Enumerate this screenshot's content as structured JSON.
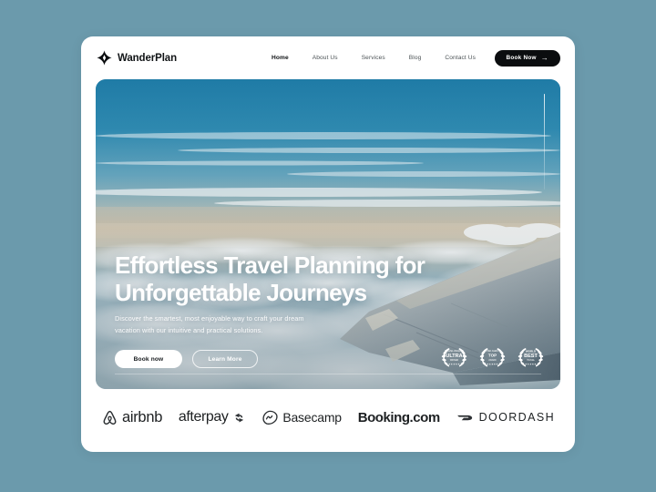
{
  "theme": {
    "page_background": "#6b9aac",
    "card_background": "#ffffff",
    "accent_dark": "#0b0d0f",
    "text_primary": "#111416",
    "text_muted": "#4c5356",
    "hero_sky_top": "#2a7fa8",
    "hero_haze": "#cfc3ad",
    "hero_cloud": "#e3eef3"
  },
  "navbar": {
    "logo_icon": "compass-star-icon",
    "brand": "WanderPlan",
    "links": [
      {
        "label": "Home",
        "active": true
      },
      {
        "label": "About Us",
        "active": false
      },
      {
        "label": "Services",
        "active": false
      },
      {
        "label": "Blog",
        "active": false
      },
      {
        "label": "Contact Us",
        "active": false
      }
    ],
    "cta": {
      "label": "Book Now",
      "icon": "arrow-right-icon",
      "arrow": "→"
    }
  },
  "hero": {
    "image_alt": "airplane-wing-above-clouds",
    "title_line1": "Effortless Travel Planning for",
    "title_line2": "Unforgettable Journeys",
    "subtitle_line1": "Discover the smartest, most enjoyable way to craft your dream",
    "subtitle_line2": "vacation with our intuitive and practical solutions.",
    "primary_cta": "Book now",
    "secondary_cta": "Learn More",
    "scroll_indicator": "vertical-scroll-line",
    "awards": [
      {
        "icon": "laurel-wreath-badge-icon",
        "title": "ULTRA",
        "sub1": "TRAVEL AWARDS",
        "sub2": "WINNER",
        "stars": "★★★★★"
      },
      {
        "icon": "laurel-wreath-badge-icon",
        "title": "TOP",
        "sub1": "RATED AGENCY",
        "sub2": "AWARD",
        "stars": "★★★★★"
      },
      {
        "icon": "laurel-wreath-badge-icon",
        "title": "BEST",
        "sub1": "WORLD",
        "sub2": "TRAVEL",
        "stars": "★★★★★"
      }
    ]
  },
  "partners": [
    {
      "name": "airbnb",
      "icon": "airbnb-belo-icon",
      "label": "airbnb"
    },
    {
      "name": "afterpay",
      "icon": "afterpay-arrows-icon",
      "label": "afterpay"
    },
    {
      "name": "basecamp",
      "icon": "basecamp-hill-icon",
      "label": "Basecamp"
    },
    {
      "name": "booking-com",
      "icon": "none",
      "label": "Booking.com"
    },
    {
      "name": "doordash",
      "icon": "doordash-swoosh-icon",
      "label": "DOORDASH"
    }
  ]
}
